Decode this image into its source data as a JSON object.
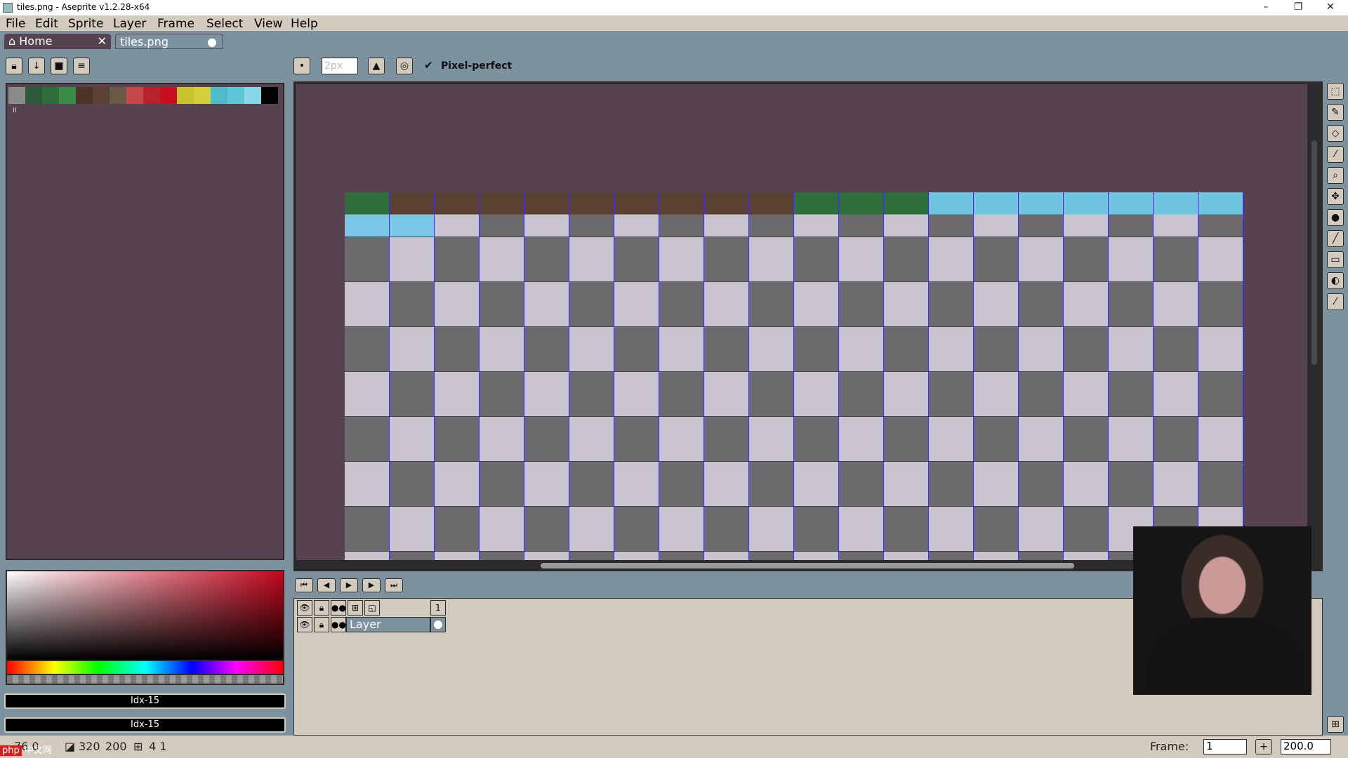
{
  "window": {
    "title": "tiles.png - Aseprite v1.2.28-x64",
    "minimize_icon": "minimize-icon",
    "maximize_icon": "restore-icon",
    "close_icon": "close-icon"
  },
  "menu": [
    "File",
    "Edit",
    "Sprite",
    "Layer",
    "Frame",
    "Select",
    "View",
    "Help"
  ],
  "tabs": [
    {
      "label": "Home",
      "icon": "home-icon",
      "close": "✕"
    },
    {
      "label": "tiles.png",
      "modified": "●"
    }
  ],
  "palette_toolbar": {
    "buttons": [
      "lock-icon",
      "download-icon",
      "square-icon",
      "menu-icon"
    ]
  },
  "brush_toolbar": {
    "size_placeholder": "2px",
    "pixel_perfect_label": "Pixel-perfect",
    "pixel_perfect_checked": true
  },
  "palette": {
    "colors": [
      "#8a8a8a",
      "#2d5a3a",
      "#2e6e3a",
      "#3b8a45",
      "#4a3528",
      "#5a4132",
      "#6b5a45",
      "#c44a4a",
      "#b7222f",
      "#c90f1f",
      "#c9c230",
      "#d7cf3a",
      "#4dbcc7",
      "#5fc6d9",
      "#8ad6e8",
      "#000000"
    ],
    "selected_index_marker": "II"
  },
  "color_fields": {
    "foreground": "Idx-15",
    "background": "Idx-15"
  },
  "tools": [
    "marquee-icon",
    "pencil-icon",
    "eraser-icon",
    "eyedropper-icon",
    "zoom-icon",
    "move-icon",
    "fill-icon",
    "line-icon",
    "rectangle-icon",
    "contour-icon",
    "blur-icon"
  ],
  "playback": [
    "first-frame-icon",
    "prev-frame-icon",
    "play-icon",
    "next-frame-icon",
    "last-frame-icon"
  ],
  "timeline": {
    "frame_header": "1",
    "layer_name": "Layer"
  },
  "status": {
    "position": "76 0",
    "size_w": "320",
    "size_h": "200",
    "grid": "4  1",
    "frame_label": "Frame:",
    "frame_value": "1",
    "zoom_value": "200.0"
  },
  "watermark": {
    "badge": "php",
    "text": "中文网"
  },
  "colors": {
    "canvas_bg": "#56434f",
    "grid_line": "#3a35c8",
    "ui_bg": "#d3cbbe",
    "ui_frame": "#7d929f"
  }
}
